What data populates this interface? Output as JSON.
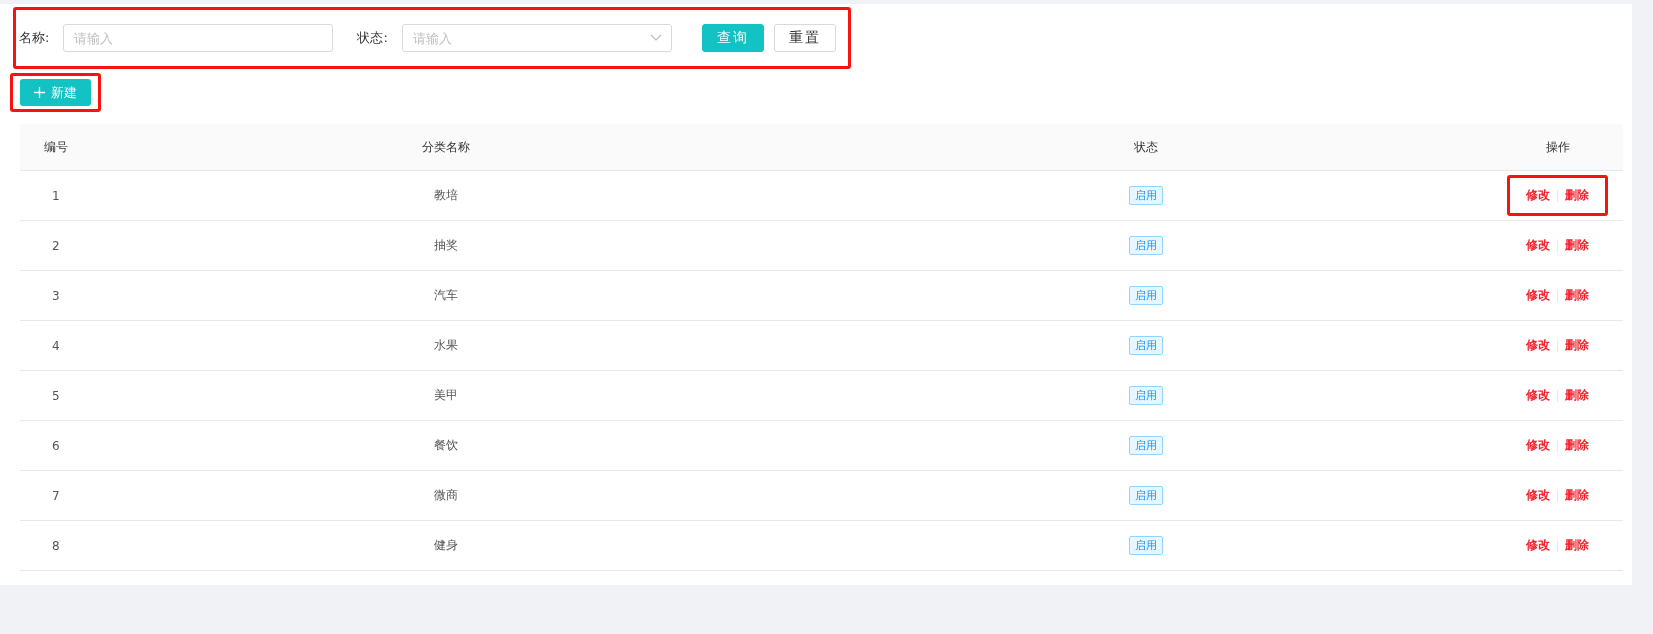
{
  "search_form": {
    "highlighted": true,
    "fields": [
      {
        "label": "名称:",
        "placeholder": "请输入",
        "kind": "text"
      },
      {
        "label": "状态:",
        "placeholder": "请输入",
        "kind": "select"
      }
    ],
    "buttons": [
      {
        "label": "查询",
        "kind": "primary"
      },
      {
        "label": "重置",
        "kind": "default"
      }
    ]
  },
  "new_button": {
    "label": "新建",
    "highlighted": true
  },
  "table": {
    "columns": [
      "编号",
      "分类名称",
      "状态",
      "操作"
    ],
    "rows": [
      {
        "id": "1",
        "name": "教培",
        "status": "启用",
        "actions": [
          "修改",
          "删除"
        ],
        "highlighted": true
      },
      {
        "id": "2",
        "name": "抽奖",
        "status": "启用",
        "actions": [
          "修改",
          "删除"
        ],
        "highlighted": false
      },
      {
        "id": "3",
        "name": "汽车",
        "status": "启用",
        "actions": [
          "修改",
          "删除"
        ],
        "highlighted": false
      },
      {
        "id": "4",
        "name": "水果",
        "status": "启用",
        "actions": [
          "修改",
          "删除"
        ],
        "highlighted": false
      },
      {
        "id": "5",
        "name": "美甲",
        "status": "启用",
        "actions": [
          "修改",
          "删除"
        ],
        "highlighted": false
      },
      {
        "id": "6",
        "name": "餐饮",
        "status": "启用",
        "actions": [
          "修改",
          "删除"
        ],
        "highlighted": false
      },
      {
        "id": "7",
        "name": "微商",
        "status": "启用",
        "actions": [
          "修改",
          "删除"
        ],
        "highlighted": false
      },
      {
        "id": "8",
        "name": "健身",
        "status": "启用",
        "actions": [
          "修改",
          "删除"
        ],
        "highlighted": false
      }
    ]
  }
}
